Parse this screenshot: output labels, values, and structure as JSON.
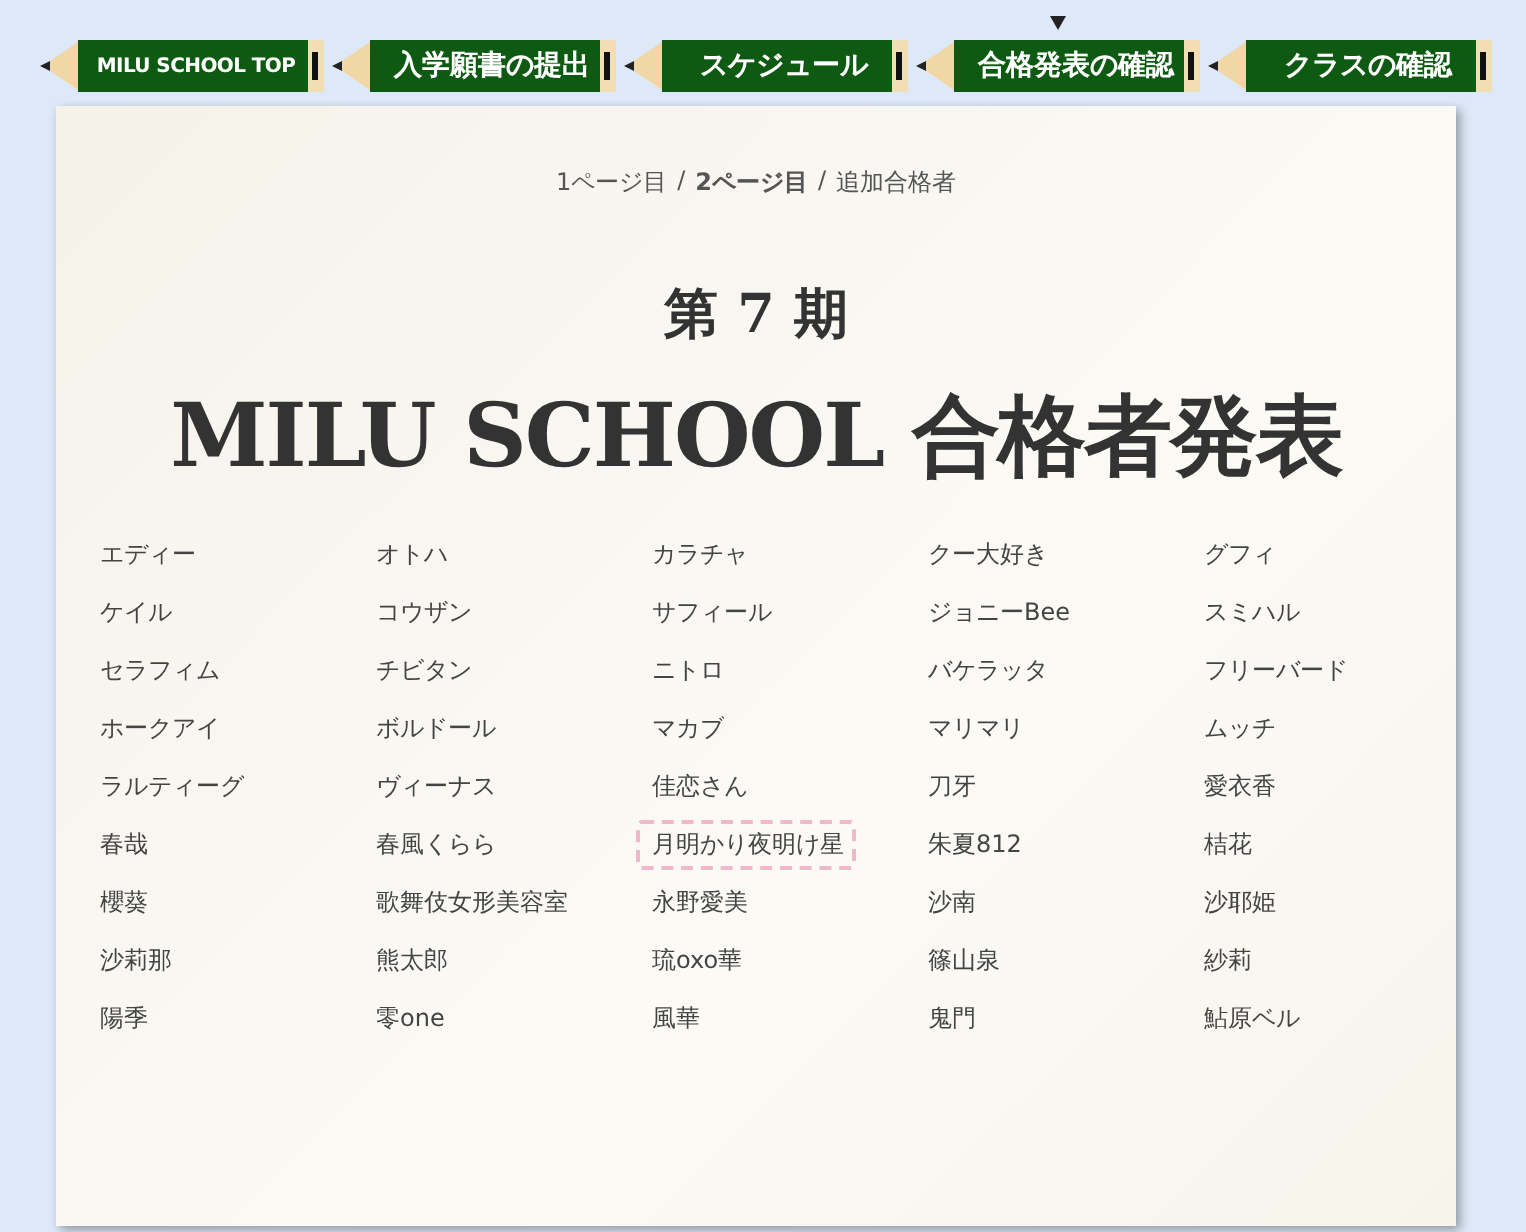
{
  "nav": {
    "tabs": [
      {
        "label": "MILU SCHOOL TOP",
        "selected": false
      },
      {
        "label": "入学願書の提出",
        "selected": false
      },
      {
        "label": "スケジュール",
        "selected": false
      },
      {
        "label": "合格発表の確認",
        "selected": true
      },
      {
        "label": "クラスの確認",
        "selected": false
      }
    ]
  },
  "breadcrumb": {
    "separator": "/",
    "items": [
      {
        "label": "1ページ目",
        "selected": false
      },
      {
        "label": "2ページ目",
        "selected": true
      },
      {
        "label": "追加合格者",
        "selected": false
      }
    ]
  },
  "term": "第 7 期",
  "heading": "MILU SCHOOL 合格者発表",
  "names": [
    {
      "name": "エディー",
      "highlighted": false
    },
    {
      "name": "オトハ",
      "highlighted": false
    },
    {
      "name": "カラチャ",
      "highlighted": false
    },
    {
      "name": "クー大好き",
      "highlighted": false
    },
    {
      "name": "グフィ",
      "highlighted": false
    },
    {
      "name": "ケイル",
      "highlighted": false
    },
    {
      "name": "コウザン",
      "highlighted": false
    },
    {
      "name": "サフィール",
      "highlighted": false
    },
    {
      "name": "ジョニーBee",
      "highlighted": false
    },
    {
      "name": "スミハル",
      "highlighted": false
    },
    {
      "name": "セラフィム",
      "highlighted": false
    },
    {
      "name": "チビタン",
      "highlighted": false
    },
    {
      "name": "ニトロ",
      "highlighted": false
    },
    {
      "name": "バケラッタ",
      "highlighted": false
    },
    {
      "name": "フリーバード",
      "highlighted": false
    },
    {
      "name": "ホークアイ",
      "highlighted": false
    },
    {
      "name": "ボルドール",
      "highlighted": false
    },
    {
      "name": "マカブ",
      "highlighted": false
    },
    {
      "name": "マリマリ",
      "highlighted": false
    },
    {
      "name": "ムッチ",
      "highlighted": false
    },
    {
      "name": "ラルティーグ",
      "highlighted": false
    },
    {
      "name": "ヴィーナス",
      "highlighted": false
    },
    {
      "name": "佳恋さん",
      "highlighted": false
    },
    {
      "name": "刀牙",
      "highlighted": false
    },
    {
      "name": "愛衣香",
      "highlighted": false
    },
    {
      "name": "春哉",
      "highlighted": false
    },
    {
      "name": "春風くらら",
      "highlighted": false
    },
    {
      "name": "月明かり夜明け星",
      "highlighted": true
    },
    {
      "name": "朱夏812",
      "highlighted": false
    },
    {
      "name": "桔花",
      "highlighted": false
    },
    {
      "name": "櫻葵",
      "highlighted": false
    },
    {
      "name": "歌舞伎女形美容室",
      "highlighted": false
    },
    {
      "name": "永野愛美",
      "highlighted": false
    },
    {
      "name": "沙南",
      "highlighted": false
    },
    {
      "name": "沙耶姫",
      "highlighted": false
    },
    {
      "name": "沙莉那",
      "highlighted": false
    },
    {
      "name": "熊太郎",
      "highlighted": false
    },
    {
      "name": "琉oxo華",
      "highlighted": false
    },
    {
      "name": "篠山泉",
      "highlighted": false
    },
    {
      "name": "紗莉",
      "highlighted": false
    },
    {
      "name": "陽季",
      "highlighted": false
    },
    {
      "name": "零one",
      "highlighted": false
    },
    {
      "name": "風華",
      "highlighted": false
    },
    {
      "name": "鬼門",
      "highlighted": false
    },
    {
      "name": "鮎原ベル",
      "highlighted": false
    }
  ]
}
